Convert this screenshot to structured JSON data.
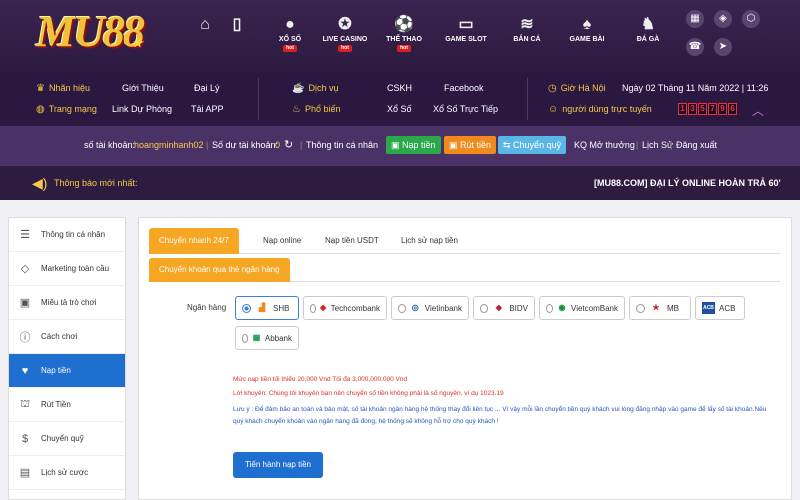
{
  "logo": {
    "text": "MU88"
  },
  "nav": [
    {
      "icon": "home-icon",
      "glyph": "⌂",
      "label": "",
      "hot": ""
    },
    {
      "icon": "mobile-icon",
      "glyph": "▯",
      "label": "",
      "hot": ""
    },
    {
      "icon": "lottery-icon",
      "glyph": "●",
      "label": "XỔ SỐ",
      "hot": "hot"
    },
    {
      "icon": "casino-chip-icon",
      "glyph": "✪",
      "label": "LIVE CASINO",
      "hot": "hot"
    },
    {
      "icon": "soccer-ball-icon",
      "glyph": "⚽",
      "label": "THỂ THAO",
      "hot": "hot"
    },
    {
      "icon": "game-slot-icon",
      "glyph": "▭",
      "label": "GAME SLOT",
      "hot": ""
    },
    {
      "icon": "fish-icon",
      "glyph": "≋",
      "label": "BẮN CÁ",
      "hot": ""
    },
    {
      "icon": "cards-icon",
      "glyph": "♠",
      "label": "GAME BÀI",
      "hot": ""
    },
    {
      "icon": "rooster-icon",
      "glyph": "♞",
      "label": "ĐÁ GÀ",
      "hot": ""
    }
  ],
  "links": {
    "nhan_hieu": "Nhãn hiệu",
    "gioi_thieu": "Giới Thiệu",
    "dai_ly": "Đại Lý",
    "trang_mang": "Trang mạng",
    "link_du_phong": "Link Dự Phòng",
    "tai_app": "Tải APP",
    "dich_vu": "Dịch vụ",
    "cskh": "CSKH",
    "facebook": "Facebook",
    "pho_bien": "Phổ biến",
    "xo_so": "Xổ Số",
    "xo_so_truc_tiep": "Xổ Số Trực Tiếp",
    "gio_ha_noi": "Giờ Hà Nội",
    "date": "Ngày 02 Tháng 11 Năm 2022 | 11:26",
    "online_label": "người dùng trực tuyến",
    "online_digits": [
      "1",
      "3",
      "5",
      "7",
      "9",
      "6"
    ]
  },
  "account": {
    "tk_label": "số tài khoản:",
    "username": "hoangminhanh02",
    "balance_label": "Số dư tài khoản:",
    "balance": "0",
    "profile": "Thông tin cá nhân",
    "deposit": "Nạp tiền",
    "withdraw": "Rút tiền",
    "transfer": "Chuyển quỹ",
    "results": "KQ Mở thưởng",
    "history": "Lịch Sử",
    "logout": "Đăng xuất"
  },
  "notice": {
    "label": "Thông báo mới nhất:",
    "marquee": "[MU88.COM] ĐẠI LÝ ONLINE HOÀN TRẢ 60'"
  },
  "sidebar": [
    {
      "icon": "user-profile-icon",
      "glyph": "☰",
      "label": "Thông tin cá nhân"
    },
    {
      "icon": "diamond-icon",
      "glyph": "◇",
      "label": "Marketing toàn cầu"
    },
    {
      "icon": "gamepad-icon",
      "glyph": "▣",
      "label": "Miêu tả trò chơi"
    },
    {
      "icon": "info-icon",
      "glyph": "ⓘ",
      "label": "Cách chơi"
    },
    {
      "icon": "piggy-bank-icon",
      "glyph": "♥",
      "label": "Nạp tiền"
    },
    {
      "icon": "withdraw-icon",
      "glyph": "⛫",
      "label": "Rút Tiền"
    },
    {
      "icon": "dollar-icon",
      "glyph": "$",
      "label": "Chuyển quỹ"
    },
    {
      "icon": "history-icon",
      "glyph": "▤",
      "label": "Lịch sử cược"
    }
  ],
  "tabs": [
    "Chuyển nhanh 24/7",
    "Nạp online",
    "Nạp tiền USDT",
    "Lịch sử nạp tiền"
  ],
  "subtab": "Chuyển khoản qua thẻ ngân hàng",
  "bank_label": "Ngân hàng",
  "banks": [
    {
      "name": "SHB",
      "logo": "SHB",
      "color": "#f08a1c",
      "selected": true
    },
    {
      "name": "Techcombank",
      "logo": "◆",
      "color": "#e02020",
      "selected": false
    },
    {
      "name": "Vietinbank",
      "logo": "◎",
      "color": "#1c5fb0",
      "selected": false
    },
    {
      "name": "BIDV",
      "logo": "◆",
      "color": "#c02030",
      "selected": false
    },
    {
      "name": "VietcomBank",
      "logo": "◉",
      "color": "#1a8a3a",
      "selected": false
    },
    {
      "name": "MB",
      "logo": "★",
      "color": "#d02030",
      "selected": false
    },
    {
      "name": "ACB",
      "logo": "ACB",
      "color": "#1f4fa0",
      "selected": false
    },
    {
      "name": "Abbank",
      "logo": "AB",
      "color": "#1a9a4a",
      "selected": false
    }
  ],
  "notes": {
    "limit": "Mức nạp tiền tối thiểu 20,000 Vnd Tối đa 3,000,000,000 Vnd",
    "advice": "Lời khuyên: Chúng tôi khuyên bạn nên chuyển số tiền không phải là số nguyên, ví dụ 1023.19",
    "caution": "Lưu ý : Để đảm bảo an toàn và bảo mật, số tài khoản ngân hàng hệ thống thay đổi liên tục ... Vì vậy mỗi lần chuyển tiền quý khách vui lòng đăng nhập vào game để lấy số tài khoản.Nếu quý khách chuyển khoản vào ngân hàng đã đóng, hệ thống sẽ không hỗ trợ cho quý khách !"
  },
  "submit": "Tiến hành nạp tiền"
}
